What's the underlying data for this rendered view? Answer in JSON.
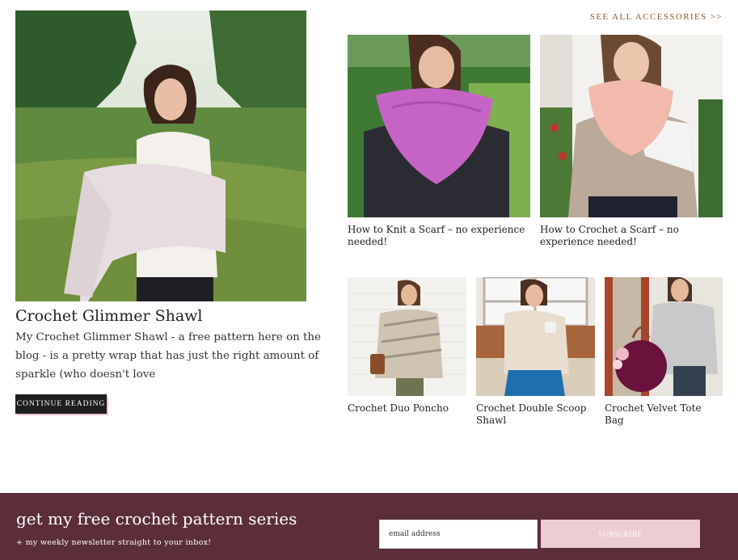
{
  "header": {
    "see_all_label": "SEE ALL ACCESSORIES >>"
  },
  "featured": {
    "title": "Crochet Glimmer Shawl",
    "excerpt": "My Crochet Glimmer Shawl - a free pattern here on the blog - is a pretty wrap that has just the right amount of sparkle (who doesn't love",
    "continue_label": "CONTINUE READING"
  },
  "cards": [
    {
      "title": "How to Knit a Scarf – no experience needed!"
    },
    {
      "title": "How to Crochet a Scarf – no experience needed!"
    },
    {
      "title": "Crochet Duo Poncho"
    },
    {
      "title": "Crochet Double Scoop Shawl"
    },
    {
      "title": "Crochet Velvet Tote Bag"
    }
  ],
  "newsletter": {
    "title": "get my free crochet pattern series",
    "subtitle": "+ my weekly newsletter straight to your inbox!",
    "email_placeholder": "email address",
    "subscribe_label": "SUBSCRIBE"
  },
  "colors": {
    "accent_link": "#8a5a2e",
    "newsletter_bg": "#5b2e3a",
    "subscribe_bg": "#ebcdd3"
  }
}
